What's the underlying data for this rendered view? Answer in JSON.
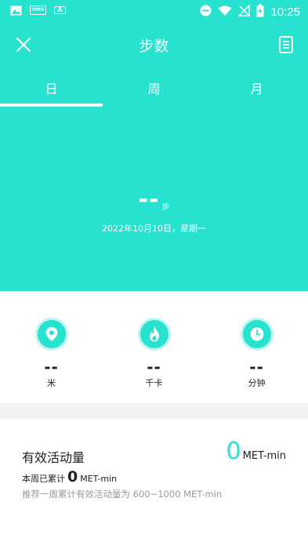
{
  "status_bar": {
    "time": "10:25",
    "left_icons": [
      "image-icon",
      "hms-tag-icon",
      "a-tag-icon"
    ],
    "left_tags": {
      "hms": "HMS",
      "a": "A"
    },
    "right_icons": [
      "dnd-icon",
      "wifi-icon",
      "no-signal-icon",
      "battery-charging-icon"
    ]
  },
  "toolbar": {
    "title": "步数",
    "close_icon": "close-icon",
    "record_icon": "document-icon"
  },
  "tabs": [
    {
      "label": "日",
      "active": true
    },
    {
      "label": "周",
      "active": false
    },
    {
      "label": "月",
      "active": false
    }
  ],
  "summary": {
    "value": "--",
    "unit": "步",
    "date": "2022年10月10日，星期一"
  },
  "stats": [
    {
      "icon": "location-pin-icon",
      "value": "--",
      "label": "米"
    },
    {
      "icon": "flame-icon",
      "value": "--",
      "label": "千卡"
    },
    {
      "icon": "clock-icon",
      "value": "--",
      "label": "分钟"
    }
  ],
  "activity": {
    "title": "有效活动量",
    "value": "0",
    "unit": "MET-min",
    "week_prefix": "本周已累计",
    "week_value": "0",
    "week_unit": "MET-min",
    "hint": "推荐一周累计有效活动量为 600~1000 MET-min"
  },
  "colors": {
    "accent": "#27e2cf",
    "accent_ring": "#bdf5ef",
    "divider": "#f2f2f2",
    "hint_text": "#9a9a9a"
  }
}
